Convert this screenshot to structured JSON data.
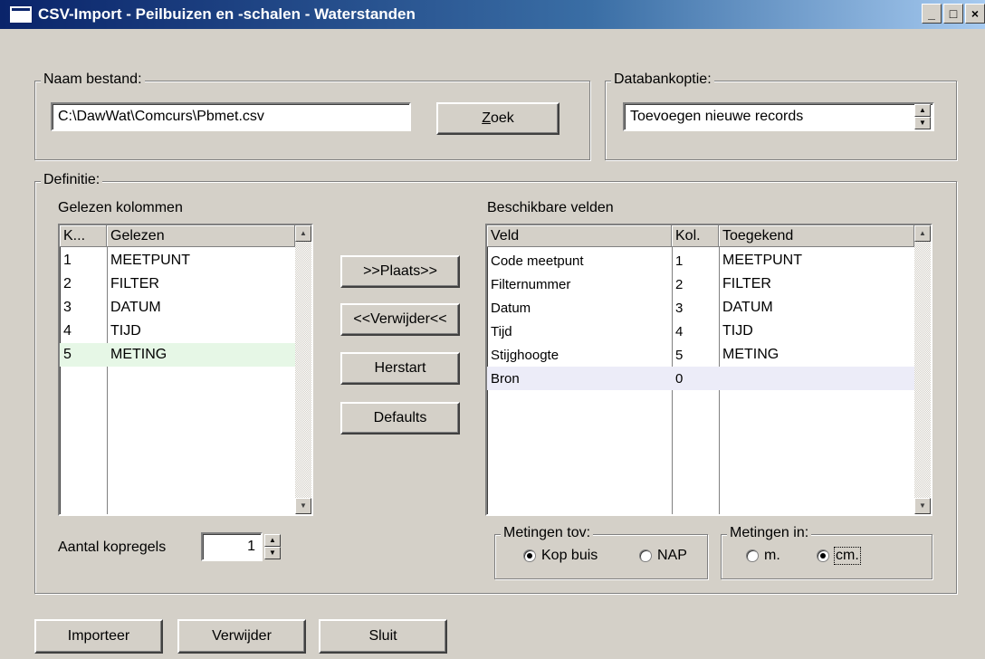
{
  "window": {
    "title": "CSV-Import - Peilbuizen en -schalen - Waterstanden",
    "minimize": "_",
    "maximize": "□",
    "close": "×"
  },
  "file": {
    "group_label": "Naam bestand:",
    "path_value": "C:\\DawWat\\Comcurs\\Pbmet.csv",
    "search_button": "Zoek",
    "search_accel": "Z",
    "search_rest": "oek"
  },
  "database": {
    "group_label": "Databankoptie:",
    "selected": "Toevoegen nieuwe records"
  },
  "definition": {
    "group_label": "Definitie:",
    "read_columns_label": "Gelezen kolommen",
    "available_fields_label": "Beschikbare velden",
    "read_columns": {
      "headers": [
        "K...",
        "Gelezen"
      ],
      "rows": [
        {
          "k": "1",
          "name": "MEETPUNT"
        },
        {
          "k": "2",
          "name": "FILTER"
        },
        {
          "k": "3",
          "name": "DATUM"
        },
        {
          "k": "4",
          "name": "TIJD"
        },
        {
          "k": "5",
          "name": "METING"
        }
      ],
      "highlight_color": "#e6f7e6"
    },
    "buttons": {
      "place": ">>Plaats>>",
      "remove": "<<Verwijder<<",
      "restart": "Herstart",
      "defaults": "Defaults"
    },
    "fields": {
      "headers": [
        "Veld",
        "Kol.",
        "Toegekend"
      ],
      "rows": [
        {
          "veld": "Code meetpunt",
          "kol": "1",
          "toegekend": "MEETPUNT"
        },
        {
          "veld": "Filternummer",
          "kol": "2",
          "toegekend": "FILTER"
        },
        {
          "veld": "Datum",
          "kol": "3",
          "toegekend": "DATUM"
        },
        {
          "veld": "Tijd",
          "kol": "4",
          "toegekend": "TIJD"
        },
        {
          "veld": "Stijghoogte",
          "kol": "5",
          "toegekend": "METING"
        },
        {
          "veld": "Bron",
          "kol": "0",
          "toegekend": ""
        }
      ],
      "highlight_color": "#ececf8"
    },
    "header_rows": {
      "label": "Aantal kopregels",
      "value": "1"
    },
    "metingen_tov": {
      "group_label": "Metingen tov:",
      "options": [
        "Kop buis",
        "NAP"
      ],
      "selected": "Kop buis"
    },
    "metingen_in": {
      "group_label": "Metingen in:",
      "options": [
        "m.",
        "cm."
      ],
      "selected": "cm."
    }
  },
  "footer": {
    "import": "Importeer",
    "delete": "Verwijder",
    "close": "Sluit"
  },
  "icons": {
    "up": "▲",
    "down": "▼"
  }
}
